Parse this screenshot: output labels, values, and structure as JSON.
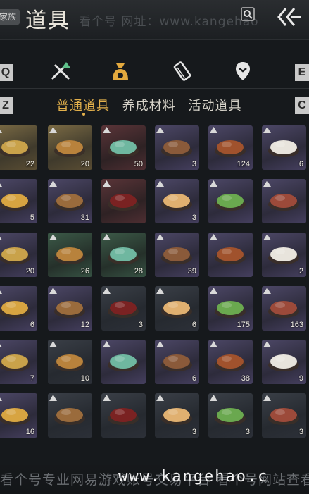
{
  "header": {
    "badge": "家族",
    "title": "道具",
    "watermark_text": "看个号   网址：www.kangehao"
  },
  "category_tabs": {
    "key_left_top": "Q",
    "key_right_top": "E",
    "key_left_bottom": "Z",
    "key_right_bottom": "C",
    "tabs": [
      {
        "icon": "crossed-swords-icon"
      },
      {
        "icon": "money-bag-icon",
        "active": true
      },
      {
        "icon": "scroll-icon"
      },
      {
        "icon": "location-pin-icon"
      }
    ]
  },
  "sub_tabs": [
    {
      "label": "普通道具",
      "active": true
    },
    {
      "label": "养成材料"
    },
    {
      "label": "活动道具"
    }
  ],
  "items": [
    {
      "name": "gold-ingot",
      "qty": "22",
      "bg": "gold"
    },
    {
      "name": "coin",
      "qty": "20",
      "bg": "gold"
    },
    {
      "name": "jade",
      "qty": "50",
      "bg": "red"
    },
    {
      "name": "braised-dish",
      "qty": "3",
      "bg": "purple"
    },
    {
      "name": "clay-pot-dish",
      "qty": "124",
      "bg": "purple"
    },
    {
      "name": "buns",
      "qty": "6",
      "bg": "purple"
    },
    {
      "name": "soup-bowl",
      "qty": "5",
      "bg": "purple"
    },
    {
      "name": "fried-fish",
      "qty": "31",
      "bg": "purple"
    },
    {
      "name": "wine-jar",
      "qty": "",
      "bg": "red"
    },
    {
      "name": "egg-plate",
      "qty": "3",
      "bg": "purple"
    },
    {
      "name": "okra-plate",
      "qty": "",
      "bg": "purple"
    },
    {
      "name": "sausage",
      "qty": "",
      "bg": "purple"
    },
    {
      "name": "stir-fry",
      "qty": "20",
      "bg": "purple"
    },
    {
      "name": "noodle-pot",
      "qty": "26",
      "bg": "green"
    },
    {
      "name": "meat-plate",
      "qty": "28",
      "bg": "green"
    },
    {
      "name": "chestnuts",
      "qty": "39",
      "bg": "purple"
    },
    {
      "name": "braised-pork",
      "qty": "",
      "bg": "purple"
    },
    {
      "name": "stew-pot",
      "qty": "2",
      "bg": "purple"
    },
    {
      "name": "meat-dish",
      "qty": "6",
      "bg": "purple"
    },
    {
      "name": "meatballs",
      "qty": "12",
      "bg": "purple"
    },
    {
      "name": "noodles",
      "qty": "3",
      "bg": "blue"
    },
    {
      "name": "noodles-2",
      "qty": "6",
      "bg": "blue"
    },
    {
      "name": "beef-pot",
      "qty": "175",
      "bg": "purple"
    },
    {
      "name": "dumplings",
      "qty": "163",
      "bg": "purple"
    },
    {
      "name": "sliced-sausage",
      "qty": "7",
      "bg": "purple"
    },
    {
      "name": "steamed-bun",
      "qty": "10",
      "bg": "blue"
    },
    {
      "name": "noodle-soup",
      "qty": "",
      "bg": "purple"
    },
    {
      "name": "porridge",
      "qty": "6",
      "bg": "purple"
    },
    {
      "name": "vase",
      "qty": "38",
      "bg": "purple"
    },
    {
      "name": "gourd",
      "qty": "9",
      "bg": "purple"
    },
    {
      "name": "stuffed-bun",
      "qty": "16",
      "bg": "purple"
    },
    {
      "name": "fabric-teal",
      "qty": "",
      "bg": "blue"
    },
    {
      "name": "fabric-orange",
      "qty": "",
      "bg": "blue"
    },
    {
      "name": "letter",
      "qty": "3",
      "bg": "blue"
    },
    {
      "name": "letter-2",
      "qty": "3",
      "bg": "blue"
    },
    {
      "name": "letter-3",
      "qty": "3",
      "bg": "blue"
    }
  ],
  "footer": {
    "watermark_cn": "看个号专业网易游戏账号交易平台   看个号网站查看",
    "watermark_url": "www.kangehao.c"
  }
}
